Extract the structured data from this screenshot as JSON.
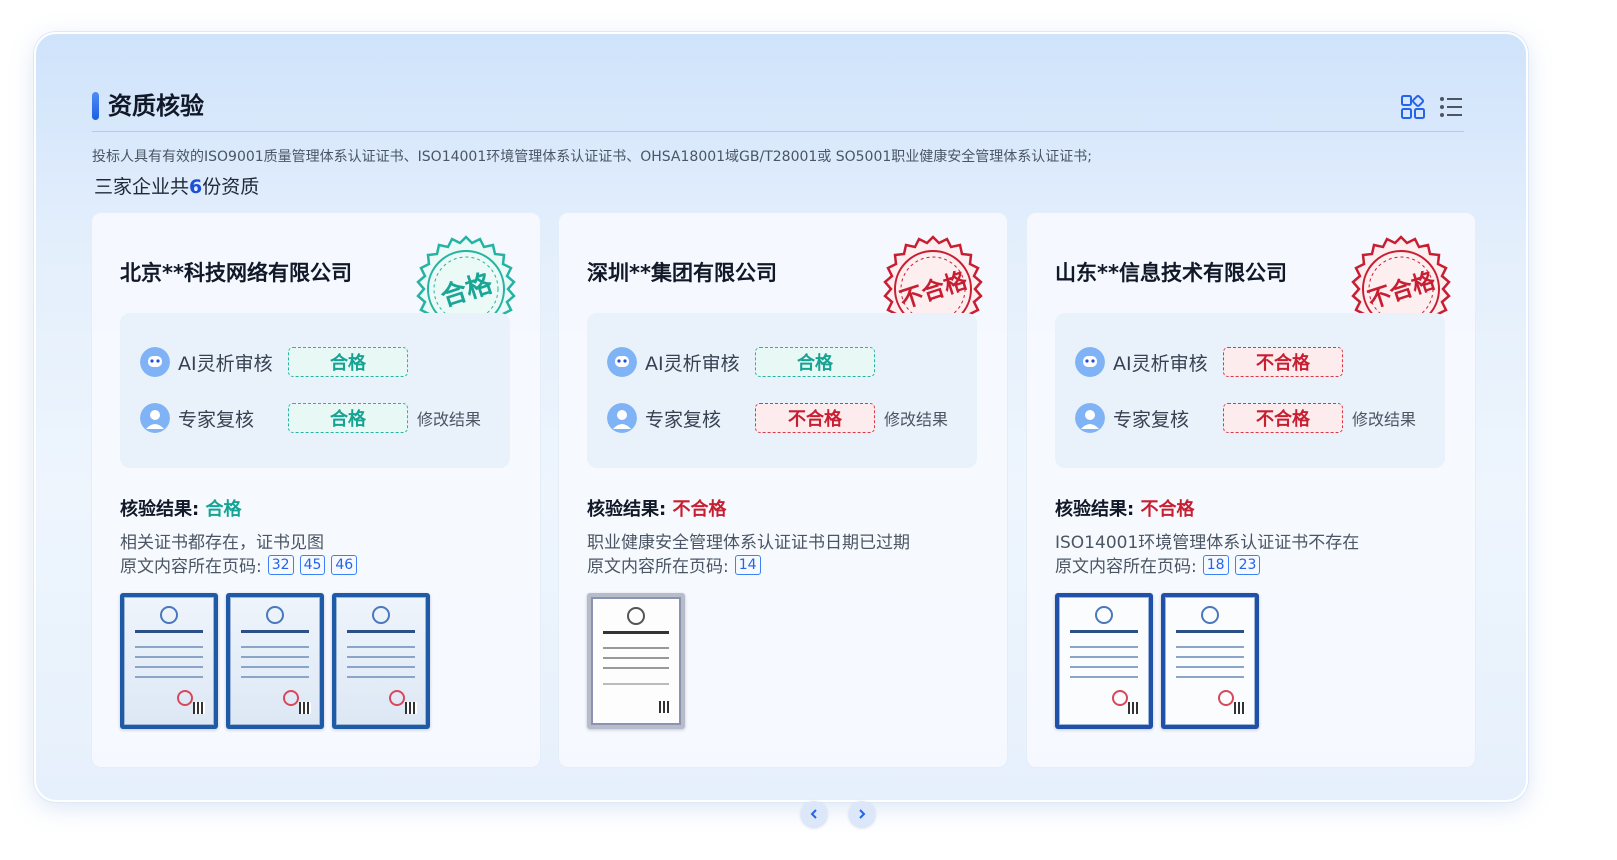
{
  "header": {
    "title": "资质核验",
    "grid_view_icon": "grid-view-icon",
    "list_view_icon": "list-view-icon"
  },
  "requirement": "投标人具有有效的ISO9001质量管理体系认证证书、ISO14001环境管理体系认证证书、OHSA18001域GB/T28001或 SO5001职业健康安全管理体系认证证书;",
  "summary": {
    "prefix": "三家企业共",
    "count": "6",
    "suffix": "份资质"
  },
  "labels": {
    "ai_review": "AI灵析审核",
    "expert_review": "专家复核",
    "modify": "修改结果",
    "result_prefix": "核验结果:",
    "pages_prefix": "原文内容所在页码:"
  },
  "colors": {
    "pass": "#16a394",
    "fail": "#c81e32",
    "accent": "#1d4ed8"
  },
  "companies": [
    {
      "name": "北京**科技网络有限公司",
      "stamp": "合格",
      "ai_result": "合格",
      "expert_result": "合格",
      "result": "合格",
      "reason": "相关证书都存在，证书见图",
      "pages": [
        "32",
        "45",
        "46"
      ]
    },
    {
      "name": "深圳**集团有限公司",
      "stamp": "不合格",
      "ai_result": "合格",
      "expert_result": "不合格",
      "result": "不合格",
      "reason": "职业健康安全管理体系认证证书日期已过期",
      "pages": [
        "14"
      ]
    },
    {
      "name": "山东**信息技术有限公司",
      "stamp": "不合格",
      "ai_result": "不合格",
      "expert_result": "不合格",
      "result": "不合格",
      "reason": "ISO14001环境管理体系认证证书不存在",
      "pages": [
        "18",
        "23"
      ]
    }
  ],
  "pager": {
    "prev_icon": "chevron-left-icon",
    "next_icon": "chevron-right-icon"
  }
}
